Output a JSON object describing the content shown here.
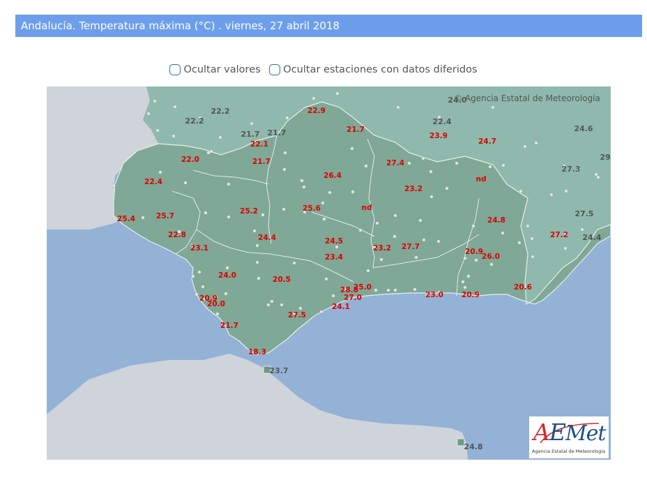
{
  "title": "Andalucía. Temperatura máxima (°C) . viernes, 27 abril 2018",
  "controls": {
    "hide_values_label": "Ocultar valores",
    "hide_deferred_label": "Ocultar estaciones con datos diferidos",
    "hide_values_checked": false,
    "hide_deferred_checked": false
  },
  "map": {
    "attribution": "© Agencia Estatal de Meteorología",
    "logo": {
      "text_a": "A",
      "text_e": "E",
      "text_met": "Met",
      "subtitle": "Agencia Estatal de Meteorología"
    },
    "colors": {
      "sea": "#94b2d6",
      "foreign_land": "#cfd4da",
      "andalucia": "#7fa896",
      "neighbour_spain": "#8eb9ac",
      "station_value": "#dd0000",
      "outside_value": "#555555",
      "title_bar": "#6d9eeb"
    },
    "station_values": [
      {
        "label": "22.9"
      },
      {
        "label": "21.7"
      },
      {
        "label": "23.9"
      },
      {
        "label": "24.7"
      },
      {
        "label": "22.1"
      },
      {
        "label": "21.7"
      },
      {
        "label": "22.0"
      },
      {
        "label": "27.4"
      },
      {
        "label": "26.4"
      },
      {
        "label": "nd"
      },
      {
        "label": "22.4"
      },
      {
        "label": "23.2"
      },
      {
        "label": "nd"
      },
      {
        "label": "25.6"
      },
      {
        "label": "25.2"
      },
      {
        "label": "25.4"
      },
      {
        "label": "25.7"
      },
      {
        "label": "24.8"
      },
      {
        "label": "22.8"
      },
      {
        "label": "24.4"
      },
      {
        "label": "24.5"
      },
      {
        "label": "27.2"
      },
      {
        "label": "23.1"
      },
      {
        "label": "23.2"
      },
      {
        "label": "27.7"
      },
      {
        "label": "20.9"
      },
      {
        "label": "26.0"
      },
      {
        "label": "23.4"
      },
      {
        "label": "24.0"
      },
      {
        "label": "20.5"
      },
      {
        "label": "28.8"
      },
      {
        "label": "25.0"
      },
      {
        "label": "20.6"
      },
      {
        "label": "27.0"
      },
      {
        "label": "23.0"
      },
      {
        "label": "20.9"
      },
      {
        "label": "20.9"
      },
      {
        "label": "20.0"
      },
      {
        "label": "24.1"
      },
      {
        "label": "27.5"
      },
      {
        "label": "21.7"
      },
      {
        "label": "18.3"
      }
    ],
    "outside_values": [
      {
        "label": "22.2"
      },
      {
        "label": "22.2"
      },
      {
        "label": "21.7"
      },
      {
        "label": "21.7"
      },
      {
        "label": "24.0"
      },
      {
        "label": "22.4"
      },
      {
        "label": "24.6"
      },
      {
        "label": "29"
      },
      {
        "label": "27.3"
      },
      {
        "label": "27.5"
      },
      {
        "label": "24.4"
      },
      {
        "label": "23.7"
      },
      {
        "label": "24.8"
      }
    ]
  }
}
